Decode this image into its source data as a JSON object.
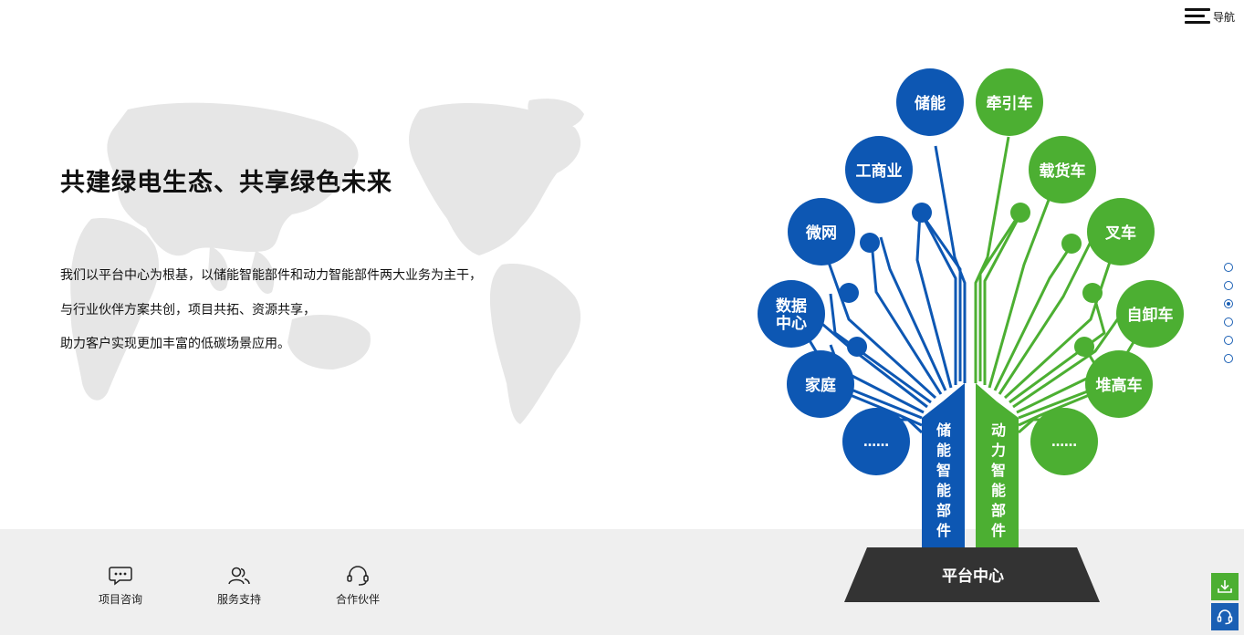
{
  "nav": {
    "label": "导航"
  },
  "hero": {
    "title": "共建绿电生态、共享绿色未来",
    "lines": [
      "我们以平台中心为根基，以储能智能部件和动力智能部件两大业务为主干，",
      "与行业伙伴方案共创，项目共拓、资源共享，",
      "助力客户实现更加丰富的低碳场景应用。"
    ]
  },
  "tree": {
    "base_label": "平台中心",
    "trunk_left": [
      "储",
      "能",
      "智",
      "能",
      "部",
      "件"
    ],
    "trunk_right": [
      "动",
      "力",
      "智",
      "能",
      "部",
      "件"
    ],
    "left_nodes": [
      {
        "lines": [
          "储能"
        ]
      },
      {
        "lines": [
          "工商业"
        ]
      },
      {
        "lines": [
          "微网"
        ]
      },
      {
        "lines": [
          "数据",
          "中心"
        ]
      },
      {
        "lines": [
          "家庭"
        ]
      },
      {
        "lines": [
          "……"
        ]
      }
    ],
    "right_nodes": [
      {
        "lines": [
          "牵引车"
        ]
      },
      {
        "lines": [
          "载货车"
        ]
      },
      {
        "lines": [
          "叉车"
        ]
      },
      {
        "lines": [
          "自卸车"
        ]
      },
      {
        "lines": [
          "堆高车"
        ]
      },
      {
        "lines": [
          "……"
        ]
      }
    ],
    "colors": {
      "blue": "#0d57b3",
      "green": "#4caf32",
      "base": "#333333"
    }
  },
  "pager": {
    "count": 6,
    "active_index": 2
  },
  "services": [
    {
      "label": "项目咨询",
      "icon": "chat-icon"
    },
    {
      "label": "服务支持",
      "icon": "users-icon"
    },
    {
      "label": "合作伙伴",
      "icon": "headset-icon"
    }
  ],
  "float_actions": [
    {
      "icon": "download-icon"
    },
    {
      "icon": "headset-icon"
    }
  ]
}
